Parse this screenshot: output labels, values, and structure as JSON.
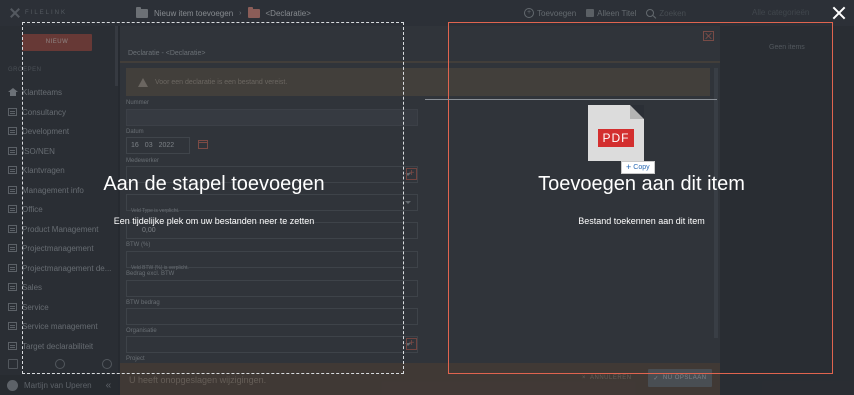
{
  "app": {
    "logo_text": "FILELINK"
  },
  "breadcrumb": {
    "parent": "Nieuw item toevoegen",
    "separator": "›",
    "current": "<Declaratie>"
  },
  "toolbar": {
    "add_label": "Toevoegen",
    "only_title_label": "Alleen Titel",
    "search_placeholder": "Zoeken",
    "all_categories": "Alle categorieën"
  },
  "sidebar": {
    "new_button": "NIEUW",
    "groups_title": "GROEPEN",
    "items": [
      {
        "label": "Klantteams",
        "icon": "home-icon"
      },
      {
        "label": "Consultancy",
        "icon": "board-icon"
      },
      {
        "label": "Development",
        "icon": "board-icon"
      },
      {
        "label": "ISO/NEN",
        "icon": "board-icon"
      },
      {
        "label": "Klantvragen",
        "icon": "board-icon"
      },
      {
        "label": "Management info",
        "icon": "board-icon"
      },
      {
        "label": "Office",
        "icon": "board-icon"
      },
      {
        "label": "Product Management",
        "icon": "board-icon"
      },
      {
        "label": "Projectmanagement",
        "icon": "board-icon"
      },
      {
        "label": "Projectmanagement de...",
        "icon": "board-icon"
      },
      {
        "label": "Sales",
        "icon": "board-icon"
      },
      {
        "label": "Service",
        "icon": "board-icon"
      },
      {
        "label": "Service management",
        "icon": "board-icon"
      },
      {
        "label": "Target declarabiliteit",
        "icon": "board-icon"
      }
    ],
    "user_name": "Martijn van Uperen",
    "collapse": "«"
  },
  "form": {
    "panel_title": "Declaratie - <Declaratie>",
    "warning": "Voor een declaratie is een bestand vereist.",
    "number_label": "Nummer",
    "date_label": "Datum",
    "date": {
      "day": "16",
      "month": "03",
      "year": "2022"
    },
    "employee_label": "Medewerker",
    "type_error": "Veld Type is verplicht.",
    "amount_value": "0,00",
    "vat_label": "BTW (%)",
    "vat_error": "Veld BTW (%) is verplicht.",
    "amount_excl_label": "Bedrag excl. BTW",
    "vat_amount_label": "BTW bedrag",
    "organisation_label": "Organisatie",
    "project_label": "Project"
  },
  "footer": {
    "unsaved": "U heeft onopgeslagen wijzigingen.",
    "cancel": "ANNULEREN",
    "save": "NU OPSLAAN"
  },
  "right_panel": {
    "no_items": "Geen items"
  },
  "drop_zones": {
    "stack_title": "Aan de stapel toevoegen",
    "stack_desc": "Een tijdelijke plek om uw bestanden neer te zetten",
    "item_title": "Toevoegen aan dit item",
    "item_desc": "Bestand toekennen aan dit item"
  },
  "drag": {
    "file_type": "PDF",
    "copy_label": "Copy"
  },
  "colors": {
    "accent": "#e0644f",
    "warning_bg": "#5d5449",
    "pdf_red": "#d32f2f"
  }
}
